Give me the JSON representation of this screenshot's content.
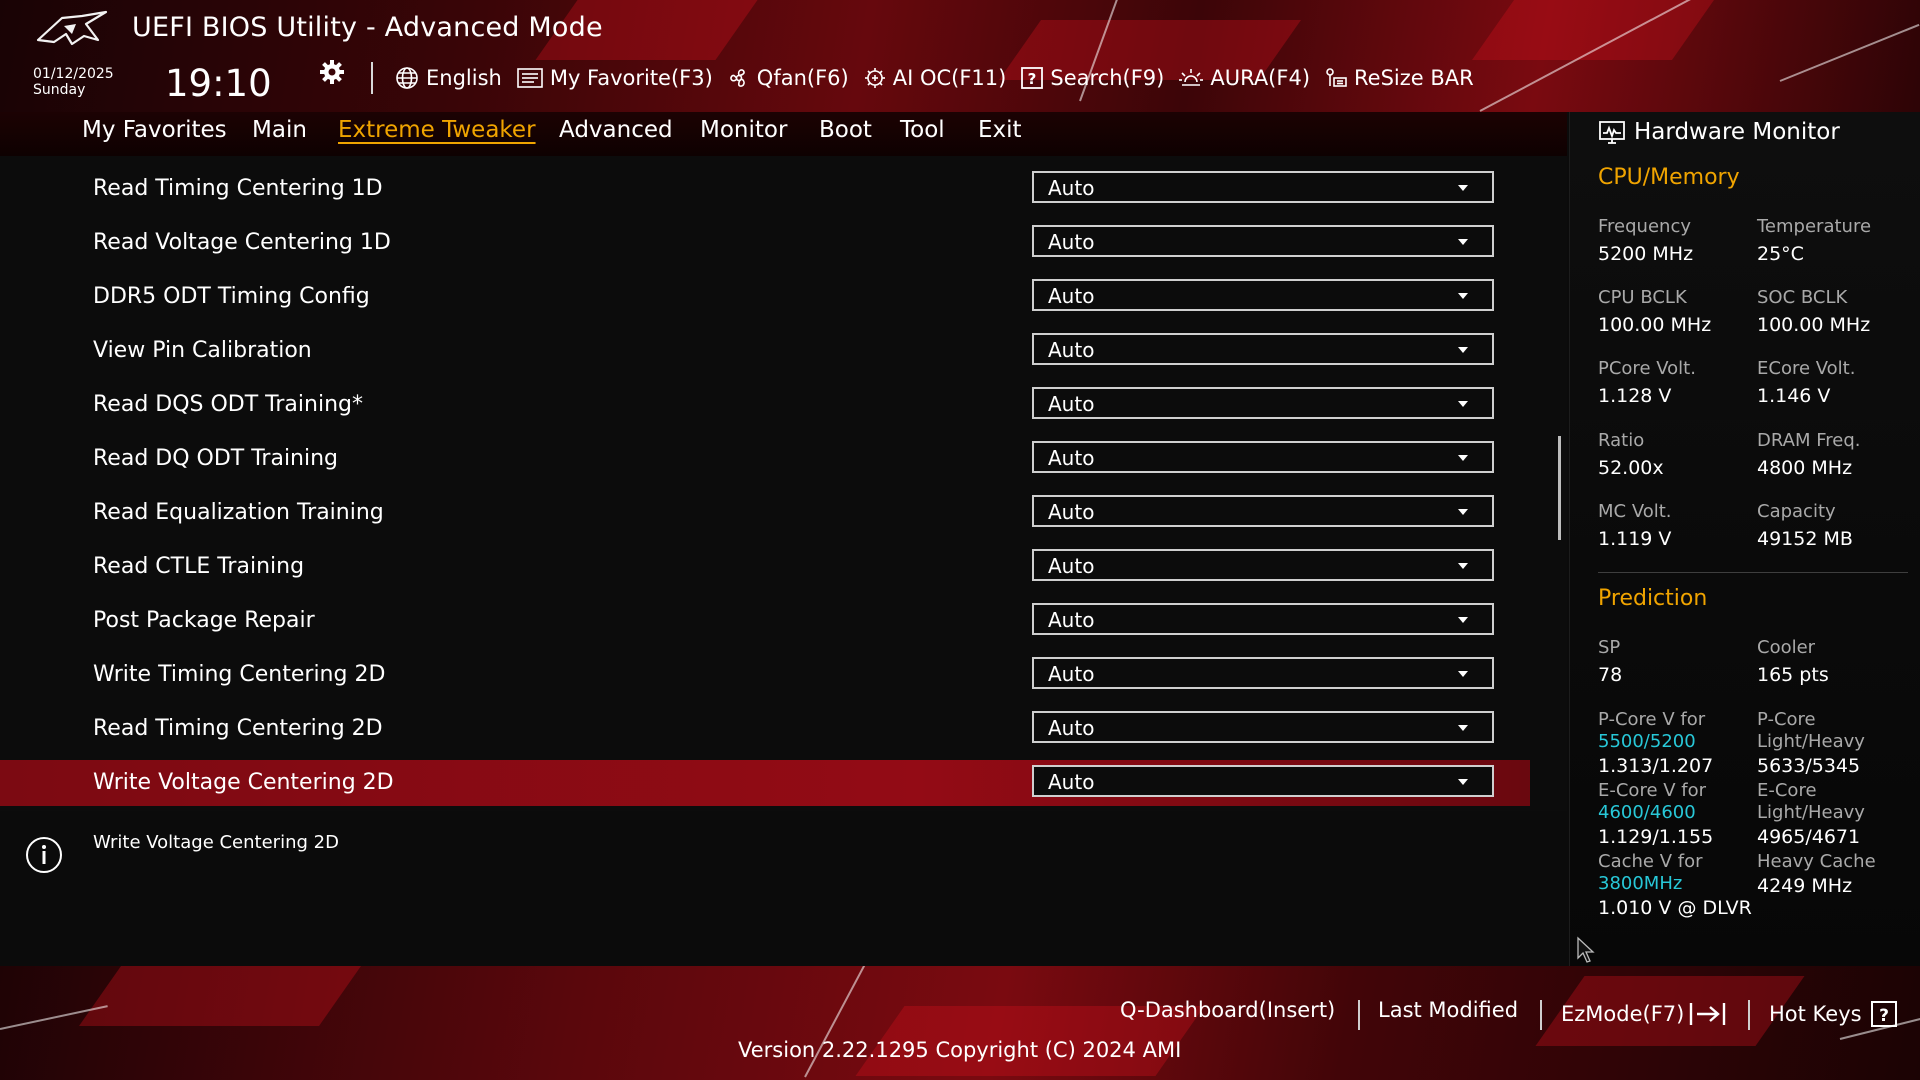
{
  "header": {
    "title": "UEFI BIOS Utility - Advanced Mode",
    "date": "01/12/2025",
    "day": "Sunday",
    "time": "19:10",
    "toolbar": [
      {
        "label": "English",
        "icon": "globe-icon"
      },
      {
        "label": "My Favorite(F3)",
        "icon": "favorite-icon"
      },
      {
        "label": "Qfan(F6)",
        "icon": "fan-icon"
      },
      {
        "label": "AI OC(F11)",
        "icon": "ai-chip-icon"
      },
      {
        "label": "Search(F9)",
        "icon": "search-help-icon"
      },
      {
        "label": "AURA(F4)",
        "icon": "aura-light-icon"
      },
      {
        "label": "ReSize BAR",
        "icon": "resize-bar-icon"
      }
    ]
  },
  "menu": {
    "items": [
      "My Favorites",
      "Main",
      "Extreme Tweaker",
      "Advanced",
      "Monitor",
      "Boot",
      "Tool",
      "Exit"
    ],
    "active": "Extreme Tweaker"
  },
  "settings": [
    {
      "label": "Read Timing Centering 1D",
      "value": "Auto"
    },
    {
      "label": "Read Voltage Centering 1D",
      "value": "Auto"
    },
    {
      "label": "DDR5 ODT Timing Config",
      "value": "Auto"
    },
    {
      "label": "View Pin Calibration",
      "value": "Auto"
    },
    {
      "label": "Read DQS ODT Training*",
      "value": "Auto"
    },
    {
      "label": "Read DQ ODT Training",
      "value": "Auto"
    },
    {
      "label": "Read Equalization Training",
      "value": "Auto"
    },
    {
      "label": "Read CTLE Training",
      "value": "Auto"
    },
    {
      "label": "Post Package Repair",
      "value": "Auto"
    },
    {
      "label": "Write Timing Centering 2D",
      "value": "Auto"
    },
    {
      "label": "Read Timing Centering 2D",
      "value": "Auto"
    },
    {
      "label": "Write Voltage Centering 2D",
      "value": "Auto",
      "selected": true
    }
  ],
  "help": {
    "text": "Write Voltage Centering 2D"
  },
  "hardware_monitor": {
    "title": "Hardware Monitor",
    "cpu_memory": {
      "title": "CPU/Memory",
      "frequency_label": "Frequency",
      "frequency": "5200 MHz",
      "temperature_label": "Temperature",
      "temperature": "25°C",
      "cpu_bclk_label": "CPU BCLK",
      "cpu_bclk": "100.00 MHz",
      "soc_bclk_label": "SOC BCLK",
      "soc_bclk": "100.00 MHz",
      "pcore_volt_label": "PCore Volt.",
      "pcore_volt": "1.128 V",
      "ecore_volt_label": "ECore Volt.",
      "ecore_volt": "1.146 V",
      "ratio_label": "Ratio",
      "ratio": "52.00x",
      "dram_freq_label": "DRAM Freq.",
      "dram_freq": "4800 MHz",
      "mc_volt_label": "MC Volt.",
      "mc_volt": "1.119 V",
      "capacity_label": "Capacity",
      "capacity": "49152 MB"
    },
    "prediction": {
      "title": "Prediction",
      "sp_label": "SP",
      "sp": "78",
      "cooler_label": "Cooler",
      "cooler": "165 pts",
      "pcore_v_label": "P-Core V for",
      "pcore_v_freq": "5500/5200",
      "pcore_v": "1.313/1.207",
      "pcore_lh_label1": "P-Core",
      "pcore_lh_label2": "Light/Heavy",
      "pcore_lh": "5633/5345",
      "ecore_v_label": "E-Core V for",
      "ecore_v_freq": "4600/4600",
      "ecore_v": "1.129/1.155",
      "ecore_lh_label1": "E-Core",
      "ecore_lh_label2": "Light/Heavy",
      "ecore_lh": "4965/4671",
      "cache_v_label": "Cache V for",
      "cache_v_freq": "3800MHz",
      "cache_v": "1.010 V @ DLVR",
      "heavy_cache_label": "Heavy Cache",
      "heavy_cache": "4249 MHz"
    }
  },
  "footer": {
    "qdashboard": "Q-Dashboard(Insert)",
    "last_modified": "Last Modified",
    "ezmode": "EzMode(F7)",
    "hotkeys": "Hot Keys",
    "version": "Version 2.22.1295 Copyright (C) 2024 AMI"
  },
  "colors": {
    "accent": "#f0a400",
    "selection": "#930b15",
    "cyan": "#28c8d8",
    "header_red": "#66080d"
  }
}
